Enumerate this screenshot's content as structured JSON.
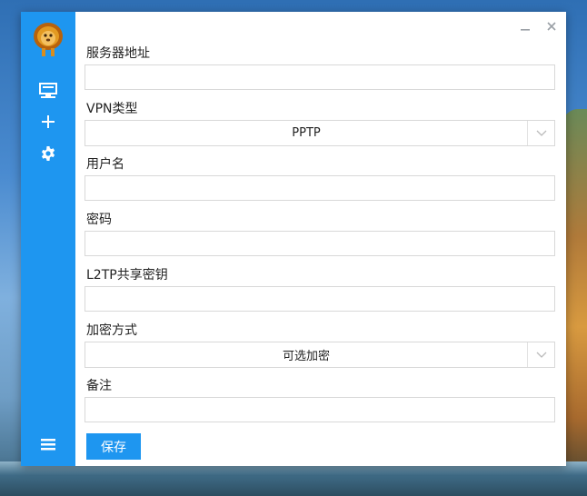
{
  "window": {
    "minimize_icon": "minimize-icon",
    "close_icon": "close-icon"
  },
  "sidebar": {
    "logo": "lion-logo",
    "icons": [
      "monitor-icon",
      "plus-icon",
      "gear-icon",
      "menu-icon"
    ],
    "color": "#1e96f0"
  },
  "form": {
    "server_label": "服务器地址",
    "server_value": "",
    "vpn_type_label": "VPN类型",
    "vpn_type_value": "PPTP",
    "username_label": "用户名",
    "username_value": "",
    "password_label": "密码",
    "password_value": "",
    "l2tp_label": "L2TP共享密钥",
    "l2tp_value": "",
    "encryption_label": "加密方式",
    "encryption_value": "可选加密",
    "note_label": "备注",
    "note_value": "",
    "save_label": "保存"
  }
}
